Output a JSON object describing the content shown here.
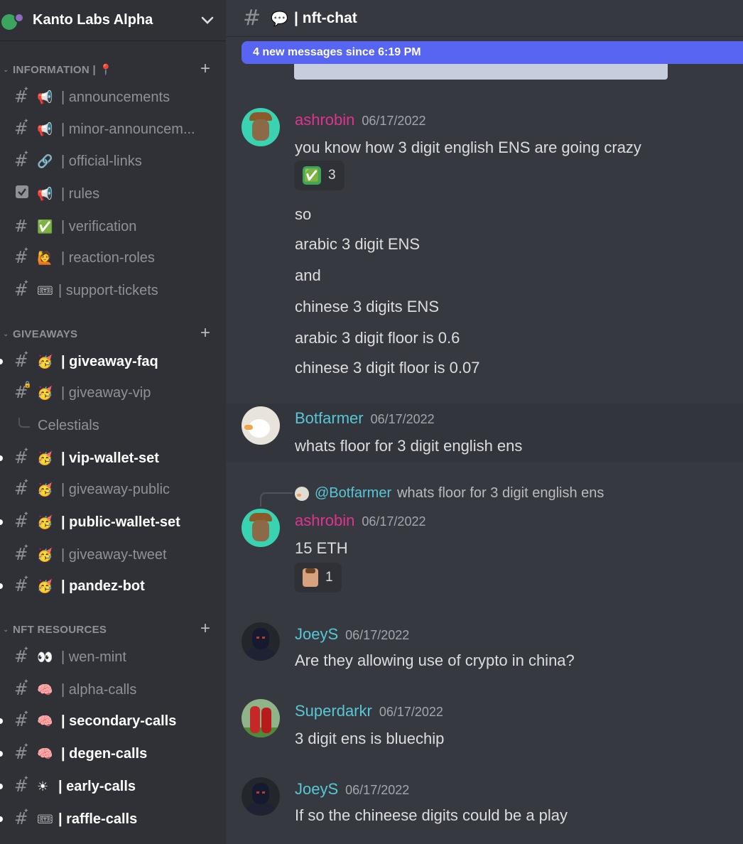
{
  "server": {
    "name": "Kanto Labs Alpha",
    "icon": "chevron-down-icon"
  },
  "sidebar": {
    "categories": [
      {
        "label": "INFORMATION | 📍"
      },
      {
        "label": "GIVEAWAYS"
      },
      {
        "label": "NFT RESOURCES"
      }
    ],
    "channels": [
      {
        "emoji": "📢",
        "name": "| announcements",
        "unread": false
      },
      {
        "emoji": "📢",
        "name": "| minor-announcem...",
        "unread": false
      },
      {
        "emoji": "🔗",
        "name": "| official-links",
        "unread": false
      },
      {
        "emoji": "📢",
        "name": "| rules",
        "unread": false,
        "icon": "rules-checkbox-icon"
      },
      {
        "emoji": "✅",
        "name": "| verification",
        "unread": false
      },
      {
        "emoji": "🙋",
        "name": "| reaction-roles",
        "unread": false
      },
      {
        "emoji": "🎟",
        "name": "| support-tickets",
        "unread": false
      },
      {
        "emoji": "🥳",
        "name": "| giveaway-faq",
        "unread": true
      },
      {
        "emoji": "🥳",
        "name": "| giveaway-vip",
        "unread": false
      },
      {
        "emoji": "🥳",
        "name": "| vip-wallet-set",
        "unread": true
      },
      {
        "emoji": "🥳",
        "name": "| giveaway-public",
        "unread": false
      },
      {
        "emoji": "🥳",
        "name": "| public-wallet-set",
        "unread": true
      },
      {
        "emoji": "🥳",
        "name": "| giveaway-tweet",
        "unread": false
      },
      {
        "emoji": "🥳",
        "name": "| pandez-bot",
        "unread": true
      },
      {
        "emoji": "👀",
        "name": "| wen-mint",
        "unread": false
      },
      {
        "emoji": "🧠",
        "name": "| alpha-calls",
        "unread": false
      },
      {
        "emoji": "🧠",
        "name": "| secondary-calls",
        "unread": true
      },
      {
        "emoji": "🧠",
        "name": "| degen-calls",
        "unread": true
      },
      {
        "emoji": "☀",
        "name": "| early-calls",
        "unread": true
      },
      {
        "emoji": "🎟",
        "name": "| raffle-calls",
        "unread": true
      }
    ],
    "thread": {
      "name": "Celestials"
    }
  },
  "channel": {
    "emoji": "💬",
    "title": "| nft-chat"
  },
  "banner": {
    "text": "4 new messages since 6:19 PM"
  },
  "messages": [
    {
      "author": "ashrobin",
      "timestamp": "06/17/2022",
      "lines": [
        "you know how 3 digit english ENS are going crazy"
      ],
      "reaction": {
        "emoji": "✅",
        "count": "3"
      },
      "followups": [
        "so",
        "arabic 3 digit ENS",
        "and",
        "chinese 3 digits ENS",
        "arabic 3 digit floor is 0.6",
        "chinese 3 digit floor is 0.07"
      ]
    },
    {
      "author": "Botfarmer",
      "timestamp": "06/17/2022",
      "lines": [
        "whats floor for 3 digit english ens"
      ]
    },
    {
      "reply": {
        "name": "@Botfarmer",
        "text": "whats floor for 3 digit english ens"
      },
      "author": "ashrobin",
      "timestamp": "06/17/2022",
      "lines": [
        "15 ETH"
      ],
      "reaction": {
        "emoji": "face-emoji",
        "count": "1"
      }
    },
    {
      "author": "JoeyS",
      "timestamp": "06/17/2022",
      "lines": [
        "Are they allowing use of crypto in china?"
      ]
    },
    {
      "author": "Superdarkr",
      "timestamp": "06/17/2022",
      "lines": [
        "3 digit ens is bluechip"
      ]
    },
    {
      "author": "JoeyS",
      "timestamp": "06/17/2022",
      "lines": [
        "If so the chineese digits could be a play"
      ]
    }
  ],
  "colors": {
    "sidebar_bg": "#2f3136",
    "main_bg": "#36393f",
    "banner": "#5865f2",
    "author_pink": "#e0338e",
    "author_cyan": "#57c7d8"
  }
}
